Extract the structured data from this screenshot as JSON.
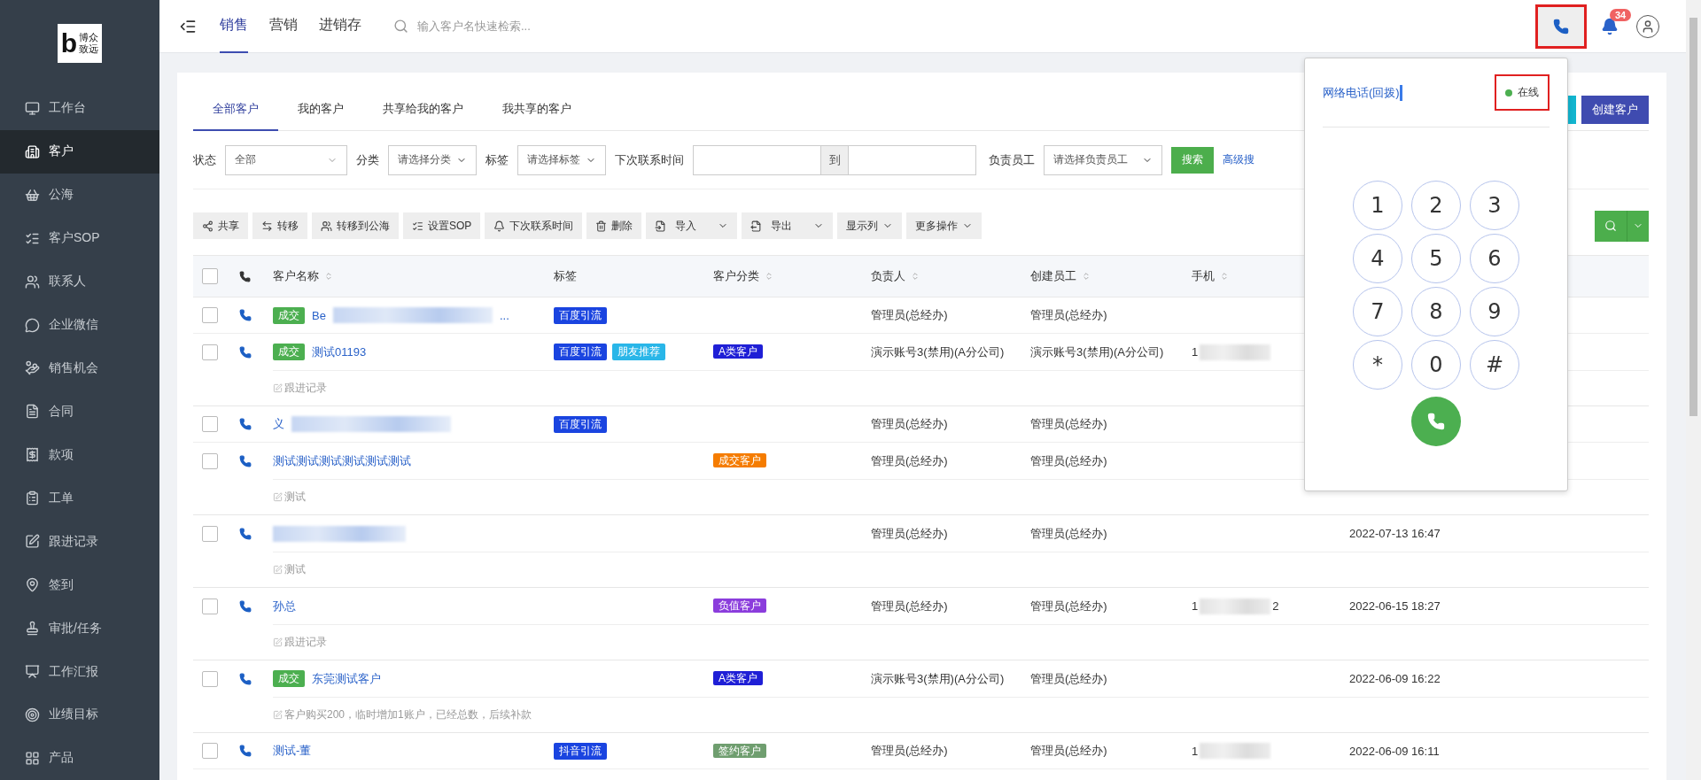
{
  "sidebar": {
    "logo_mark": "b",
    "logo_lines": [
      "博众",
      "致远"
    ],
    "items": [
      {
        "label": "工作台",
        "selected": false
      },
      {
        "label": "客户",
        "selected": true
      },
      {
        "label": "公海",
        "selected": false
      },
      {
        "label": "客户SOP",
        "selected": false
      },
      {
        "label": "联系人",
        "selected": false
      },
      {
        "label": "企业微信",
        "selected": false
      },
      {
        "label": "销售机会",
        "selected": false
      },
      {
        "label": "合同",
        "selected": false
      },
      {
        "label": "款项",
        "selected": false
      },
      {
        "label": "工单",
        "selected": false
      },
      {
        "label": "跟进记录",
        "selected": false
      },
      {
        "label": "签到",
        "selected": false
      },
      {
        "label": "审批/任务",
        "selected": false
      },
      {
        "label": "工作汇报",
        "selected": false
      },
      {
        "label": "业绩目标",
        "selected": false
      },
      {
        "label": "产品",
        "selected": false
      }
    ]
  },
  "top_nav": {
    "tabs": [
      {
        "label": "销售",
        "selected": true
      },
      {
        "label": "营销",
        "selected": false
      },
      {
        "label": "进销存",
        "selected": false
      }
    ],
    "search": {
      "placeholder": "输入客户名快速检索..."
    },
    "phone_button": {
      "highlighted": true
    },
    "notifications": {
      "count": "34"
    }
  },
  "customer_tabs": [
    {
      "label": "全部客户",
      "selected": true
    },
    {
      "label": "我的客户",
      "selected": false
    },
    {
      "label": "共享给我的客户",
      "selected": false
    },
    {
      "label": "我共享的客户",
      "selected": false
    }
  ],
  "create_button": "创建客户",
  "filters": {
    "status": {
      "label": "状态",
      "value": "全部"
    },
    "category": {
      "label": "分类",
      "placeholder": "请选择分类"
    },
    "tag": {
      "label": "标签",
      "placeholder": "请选择标签"
    },
    "next_contact": {
      "label": "下次联系时间",
      "separator": "到"
    },
    "owner": {
      "label": "负责员工",
      "placeholder": "请选择负责员工"
    },
    "search_button": "搜索",
    "advanced_link": "高级搜"
  },
  "toolbar": [
    {
      "kind": "button",
      "label": "共享"
    },
    {
      "kind": "button",
      "label": "转移"
    },
    {
      "kind": "button",
      "label": "转移到公海"
    },
    {
      "kind": "button",
      "label": "设置SOP"
    },
    {
      "kind": "button",
      "label": "下次联系时间"
    },
    {
      "kind": "button",
      "label": "删除"
    },
    {
      "kind": "split",
      "label": "导入"
    },
    {
      "kind": "split",
      "label": "导出"
    },
    {
      "kind": "dropdown",
      "label": "显示列"
    },
    {
      "kind": "dropdown",
      "label": "更多操作"
    }
  ],
  "table": {
    "select_all_checked": false,
    "columns": [
      {
        "label": "客户名称",
        "sortable": true
      },
      {
        "label": "标签",
        "sortable": false
      },
      {
        "label": "客户分类",
        "sortable": true
      },
      {
        "label": "负责人",
        "sortable": true
      },
      {
        "label": "创建员工",
        "sortable": true
      },
      {
        "label": "手机",
        "sortable": true
      }
    ],
    "rows": [
      {
        "checked": false,
        "status": "成交",
        "name": "Be",
        "name_redacted": true,
        "name_tail": "...",
        "tags": [
          {
            "label": "百度引流",
            "color": "#1a44e0"
          }
        ],
        "owner": "管理员(总经办)",
        "creator": "管理员(总经办)"
      },
      {
        "checked": false,
        "status": "成交",
        "name": "测试01193",
        "tags": [
          {
            "label": "百度引流",
            "color": "#1a44e0"
          },
          {
            "label": "朋友推荐",
            "color": "#29b6e8"
          }
        ],
        "category": {
          "label": "A类客户",
          "color": "#1f1fd6"
        },
        "owner": "演示账号3(禁用)(A分公司)",
        "creator": "演示账号3(禁用)(A分公司)",
        "phone": "1",
        "phone_redacted": true,
        "note": "跟进记录"
      },
      {
        "checked": false,
        "name": "义",
        "name_redacted": true,
        "tags": [
          {
            "label": "百度引流",
            "color": "#1a44e0"
          }
        ],
        "owner": "管理员(总经办)",
        "creator": "管理员(总经办)"
      },
      {
        "checked": false,
        "name": "测试测试测试测试测试测试",
        "tags": [],
        "category": {
          "label": "成交客户",
          "color": "#f57c00"
        },
        "owner": "管理员(总经办)",
        "creator": "管理员(总经办)",
        "note": "测试"
      },
      {
        "checked": false,
        "name_redacted": true,
        "tags": [],
        "owner": "管理员(总经办)",
        "creator": "管理员(总经办)",
        "date": "2022-07-13 16:47",
        "note": "测试"
      },
      {
        "checked": false,
        "name": "孙总",
        "tags": [],
        "category": {
          "label": "负值客户",
          "color": "#8b3ddc"
        },
        "owner": "管理员(总经办)",
        "creator": "管理员(总经办)",
        "phone": "1",
        "phone_redacted": true,
        "phone_tail": "2",
        "date": "2022-06-15 18:27",
        "note": "跟进记录"
      },
      {
        "checked": false,
        "status": "成交",
        "name": "东莞测试客户",
        "tags": [],
        "category": {
          "label": "A类客户",
          "color": "#1f1fd6"
        },
        "owner": "演示账号3(禁用)(A分公司)",
        "creator": "管理员(总经办)",
        "date": "2022-06-09 16:22",
        "note": "客户购买200，临时增加1账户，已经总数，后续补款"
      },
      {
        "checked": false,
        "name": "测试-董",
        "tags": [
          {
            "label": "抖音引流",
            "color": "#1a44e0"
          }
        ],
        "category": {
          "label": "签约客户",
          "color": "#6f9e6f"
        },
        "owner": "管理员(总经办)",
        "creator": "管理员(总经办)",
        "phone": "1",
        "phone_redacted": true,
        "date": "2022-06-09 16:11"
      }
    ]
  },
  "dialer": {
    "title": "网络电话(回拨)",
    "status": {
      "label": "在线",
      "online": true,
      "highlighted": true
    },
    "keys": [
      "1",
      "2",
      "3",
      "4",
      "5",
      "6",
      "7",
      "8",
      "9",
      "*",
      "0",
      "#"
    ]
  }
}
